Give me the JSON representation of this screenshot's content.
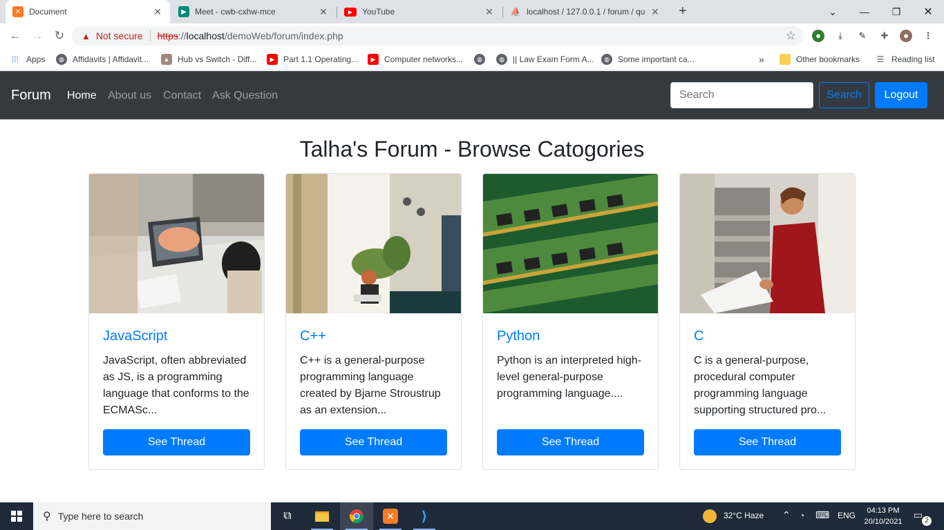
{
  "browser": {
    "tabs": [
      {
        "title": "Document",
        "active": true,
        "icon": "xampp-icon",
        "color": "#fb7a24"
      },
      {
        "title": "Meet - cwb-cxhw-mce",
        "active": false,
        "icon": "google-meet-icon",
        "color": "#00897b"
      },
      {
        "title": "YouTube",
        "active": false,
        "icon": "youtube-icon",
        "color": "#ff0000"
      },
      {
        "title": "localhost / 127.0.0.1 / forum / qu",
        "active": false,
        "icon": "phpmyadmin-icon",
        "color": "#f89c0e"
      }
    ],
    "not_secure": "Not secure",
    "url_scheme": "https",
    "url_sep": "://",
    "url_host": "localhost",
    "url_path": "/demoWeb/forum/index.php"
  },
  "bookmarks": {
    "items": [
      "Apps",
      "Affidavits | Affidavit...",
      "Hub vs Switch - Diff...",
      "Part 1.1 Operating...",
      "Computer networks...",
      "",
      "|| Law Exam Form A...",
      "Some important ca..."
    ],
    "more": "»",
    "other": "Other bookmarks",
    "reading_list": "Reading list"
  },
  "navbar": {
    "brand": "Forum",
    "links": [
      "Home",
      "About us",
      "Contact",
      "Ask Question"
    ],
    "search_placeholder": "Search",
    "search_button": "Search",
    "logout_button": "Logout"
  },
  "main": {
    "heading": "Talha's Forum - Browse Catogories",
    "cards": [
      {
        "title": "JavaScript",
        "text": "JavaScript, often abbreviated as JS, is a programming language that conforms to the ECMASc...",
        "button": "See Thread"
      },
      {
        "title": "C++",
        "text": "C++ is a general-purpose programming language created by Bjarne Stroustrup as an extension...",
        "button": "See Thread"
      },
      {
        "title": "Python",
        "text": "Python is an interpreted high-level general-purpose programming language....",
        "button": "See Thread"
      },
      {
        "title": "C",
        "text": "C is a general-purpose, procedural computer programming language supporting structured pro...",
        "button": "See Thread"
      }
    ]
  },
  "taskbar": {
    "search_placeholder": "Type here to search",
    "weather": "32°C Haze",
    "language": "ENG",
    "time": "04:13 PM",
    "date": "20/10/2021",
    "notifications": "2"
  },
  "colors": {
    "primary": "#007bff",
    "navbar_bg": "#343a40",
    "taskbar_bg": "#1f2a3a"
  }
}
